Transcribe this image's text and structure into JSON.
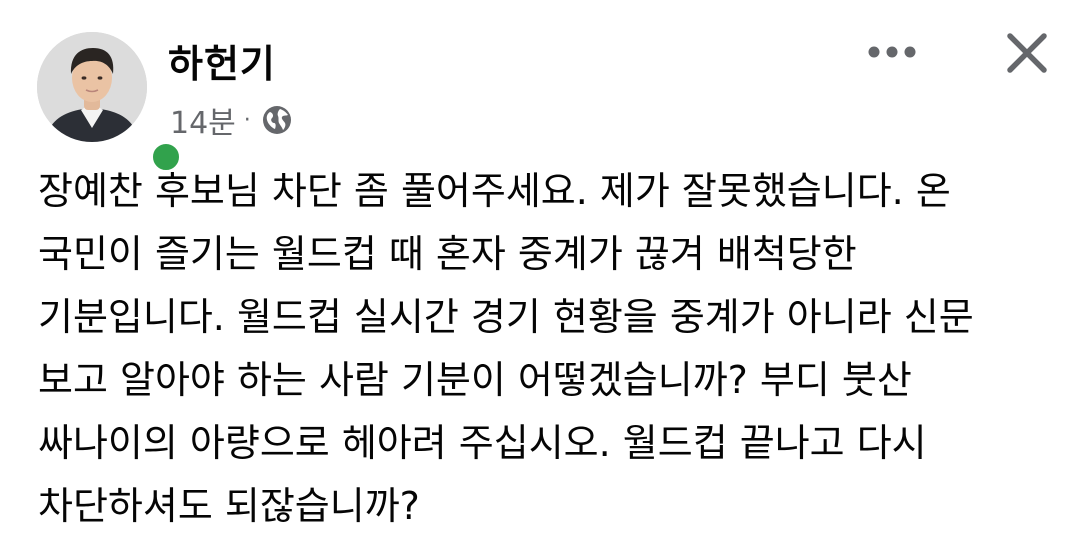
{
  "post": {
    "author": {
      "name": "하헌기",
      "avatar_icon": "profile-photo",
      "online_color": "#31a24c"
    },
    "meta": {
      "time": "14분",
      "separator": "·",
      "audience_icon": "globe-icon"
    },
    "actions": {
      "more_icon": "more-options-icon",
      "close_icon": "close-icon"
    },
    "body_lines": [
      "장예찬 후보님 차단 좀 풀어주세요. 제가 잘못했습니다. 온",
      "국민이 즐기는 월드컵 때 혼자 중계가 끊겨 배척당한",
      "기분입니다. 월드컵 실시간 경기 현황을 중계가 아니라 신문",
      "보고 알아야 하는 사람 기분이 어떻겠습니까? 부디 붓산",
      "싸나이의 아량으로 헤아려 주십시오. 월드컵 끝나고 다시",
      "차단하셔도 되잖습니까?"
    ]
  }
}
